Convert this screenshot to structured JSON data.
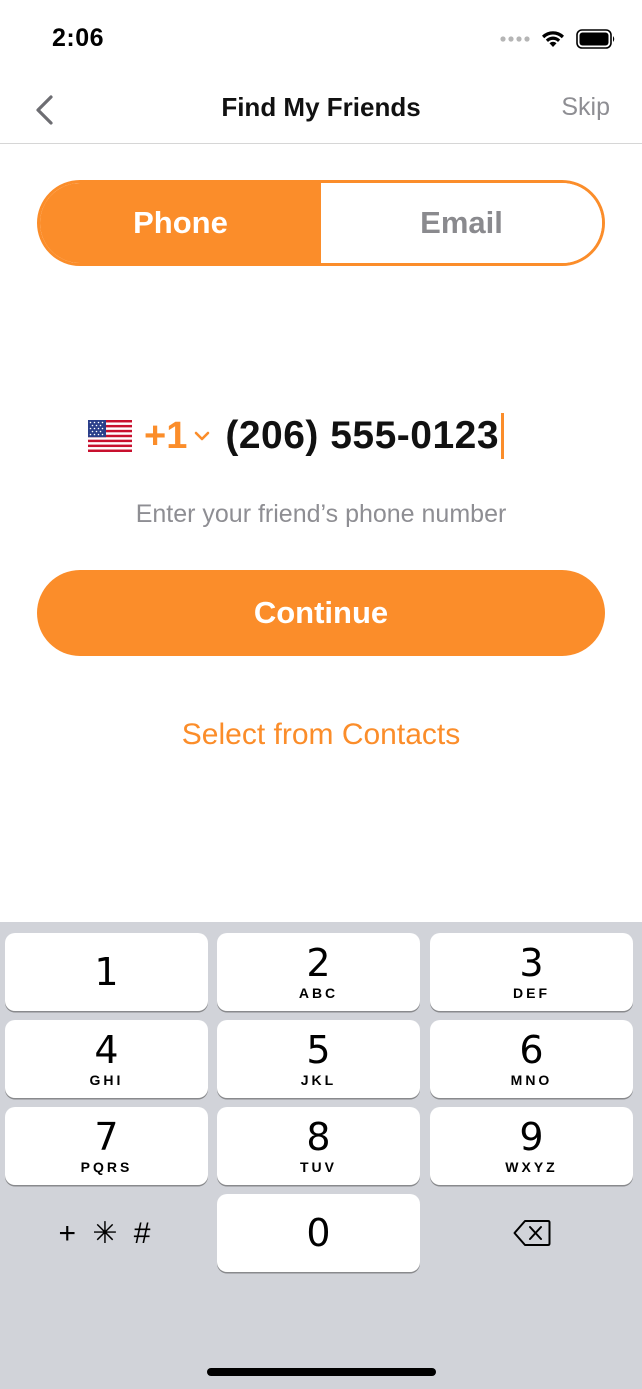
{
  "status_bar": {
    "time": "2:06"
  },
  "nav": {
    "title": "Find My Friends",
    "skip_label": "Skip"
  },
  "segments": [
    {
      "label": "Phone",
      "selected": true
    },
    {
      "label": "Email",
      "selected": false
    }
  ],
  "phone": {
    "country_flag": "us-flag-icon",
    "country_code": "+1",
    "number": "(206) 555-0123",
    "hint": "Enter your friend’s phone number"
  },
  "continue_label": "Continue",
  "contacts_link": "Select from Contacts",
  "keypad": {
    "keys": [
      {
        "num": "1",
        "letters": ""
      },
      {
        "num": "2",
        "letters": "ABC"
      },
      {
        "num": "3",
        "letters": "DEF"
      },
      {
        "num": "4",
        "letters": "GHI"
      },
      {
        "num": "5",
        "letters": "JKL"
      },
      {
        "num": "6",
        "letters": "MNO"
      },
      {
        "num": "7",
        "letters": "PQRS"
      },
      {
        "num": "8",
        "letters": "TUV"
      },
      {
        "num": "9",
        "letters": "WXYZ"
      },
      {
        "num": "0",
        "letters": ""
      }
    ],
    "symbols_label": "+ ✳ #",
    "delete_icon": "backspace-icon"
  },
  "colors": {
    "accent": "#fb8d2a",
    "keyboard_bg": "#d1d3d9",
    "muted_text": "#8e8e93"
  }
}
